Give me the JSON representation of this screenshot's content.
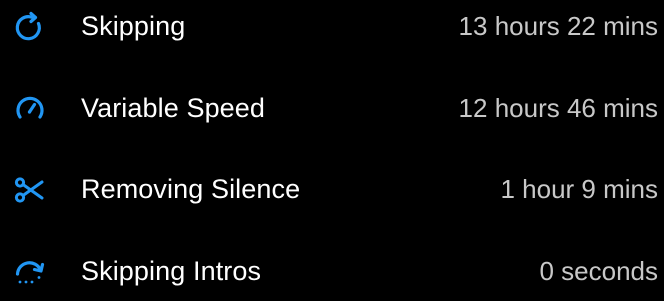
{
  "colors": {
    "background": "#000000",
    "accent": "#2196f3",
    "label": "#ffffff",
    "value": "#c8c8c8"
  },
  "stats": {
    "items": [
      {
        "icon": "skip-icon",
        "label": "Skipping",
        "value": "13 hours 22 mins"
      },
      {
        "icon": "speedometer-icon",
        "label": "Variable Speed",
        "value": "12 hours 46 mins"
      },
      {
        "icon": "scissors-icon",
        "label": "Removing Silence",
        "value": "1 hour 9 mins"
      },
      {
        "icon": "skip-intro-icon",
        "label": "Skipping Intros",
        "value": "0 seconds"
      }
    ]
  }
}
